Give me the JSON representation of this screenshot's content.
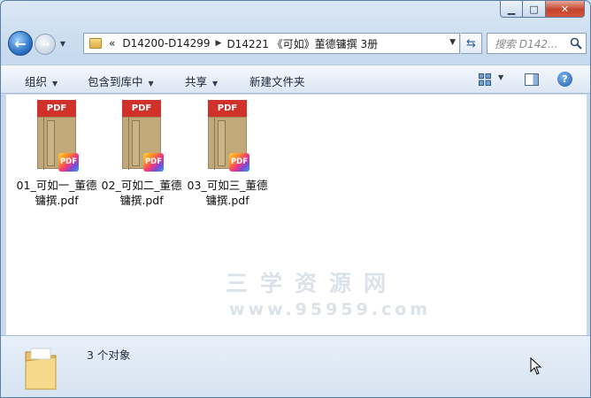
{
  "window": {
    "controls": {
      "minimize_icon": "minimize-icon",
      "maximize_icon": "maximize-icon",
      "close_icon": "close-icon"
    }
  },
  "navigation": {
    "back_icon": "arrow-left-icon",
    "forward_icon": "arrow-right-icon",
    "breadcrumb": {
      "overflow": "«",
      "items": [
        "D14200-D14299",
        "D14221 《可如》董德镛撰 3册"
      ]
    },
    "search_placeholder": "搜索 D142..."
  },
  "toolbar": {
    "organize": "组织",
    "include_in_library": "包含到库中",
    "share": "共享",
    "new_folder": "新建文件夹"
  },
  "files": [
    {
      "name": "01_可如一_董德镛撰.pdf",
      "badge": "PDF",
      "header": "PDF"
    },
    {
      "name": "02_可如二_董德镛撰.pdf",
      "badge": "PDF",
      "header": "PDF"
    },
    {
      "name": "03_可如三_董德镛撰.pdf",
      "badge": "PDF",
      "header": "PDF"
    }
  ],
  "watermark": {
    "text": "三学资源网",
    "url": "www.95959.com"
  },
  "status": {
    "count_text": "3 个对象"
  },
  "colors": {
    "pdf_red": "#d0312a",
    "toolbar_bg": "#e6eef8",
    "accent_blue": "#2e76c7"
  }
}
